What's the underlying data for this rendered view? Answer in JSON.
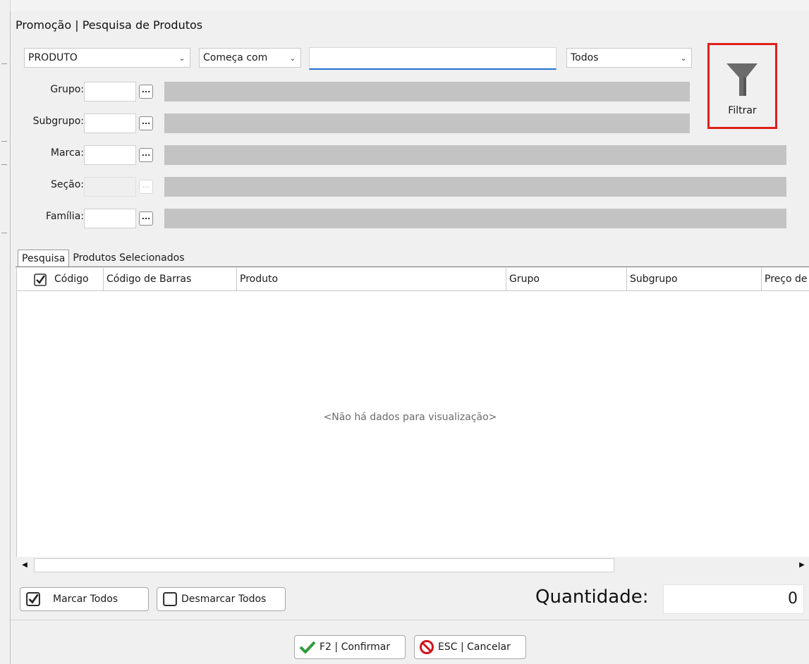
{
  "dialog": {
    "title": "Promoção | Pesquisa de Produtos"
  },
  "search": {
    "field_selected": "PRODUTO",
    "mode_selected": "Começa com",
    "query_value": "",
    "status_selected": "Todos"
  },
  "filters": [
    {
      "label": "Grupo:",
      "code": "",
      "description": "",
      "enabled": true
    },
    {
      "label": "Subgrupo:",
      "code": "",
      "description": "",
      "enabled": true
    },
    {
      "label": "Marca:",
      "code": "",
      "description": "",
      "enabled": true
    },
    {
      "label": "Seção:",
      "code": "",
      "description": "",
      "enabled": false
    },
    {
      "label": "Família:",
      "code": "",
      "description": "",
      "enabled": true
    }
  ],
  "browse_button_label": "...",
  "filter_button": {
    "label": "Filtrar",
    "icon": "funnel-icon"
  },
  "tabs": [
    {
      "label": "Pesquisa",
      "active": true
    },
    {
      "label": "Produtos Selecionados",
      "active": false
    }
  ],
  "grid": {
    "columns": [
      "Código",
      "Código de Barras",
      "Produto",
      "Grupo",
      "Subgrupo",
      "Preço de"
    ],
    "rows": [],
    "empty_text": "<Não há dados para visualização>"
  },
  "actions": {
    "mark_all": "Marcar Todos",
    "unmark_all": "Desmarcar Todos",
    "quantity_label": "Quantidade:",
    "quantity_value": "0",
    "confirm": "F2 | Confirmar",
    "cancel": "ESC | Cancelar"
  },
  "colors": {
    "highlight": "#e0201b",
    "input_focus": "#1e6fce",
    "confirm_check": "#2e9d3a",
    "cancel_icon": "#d0141c"
  }
}
